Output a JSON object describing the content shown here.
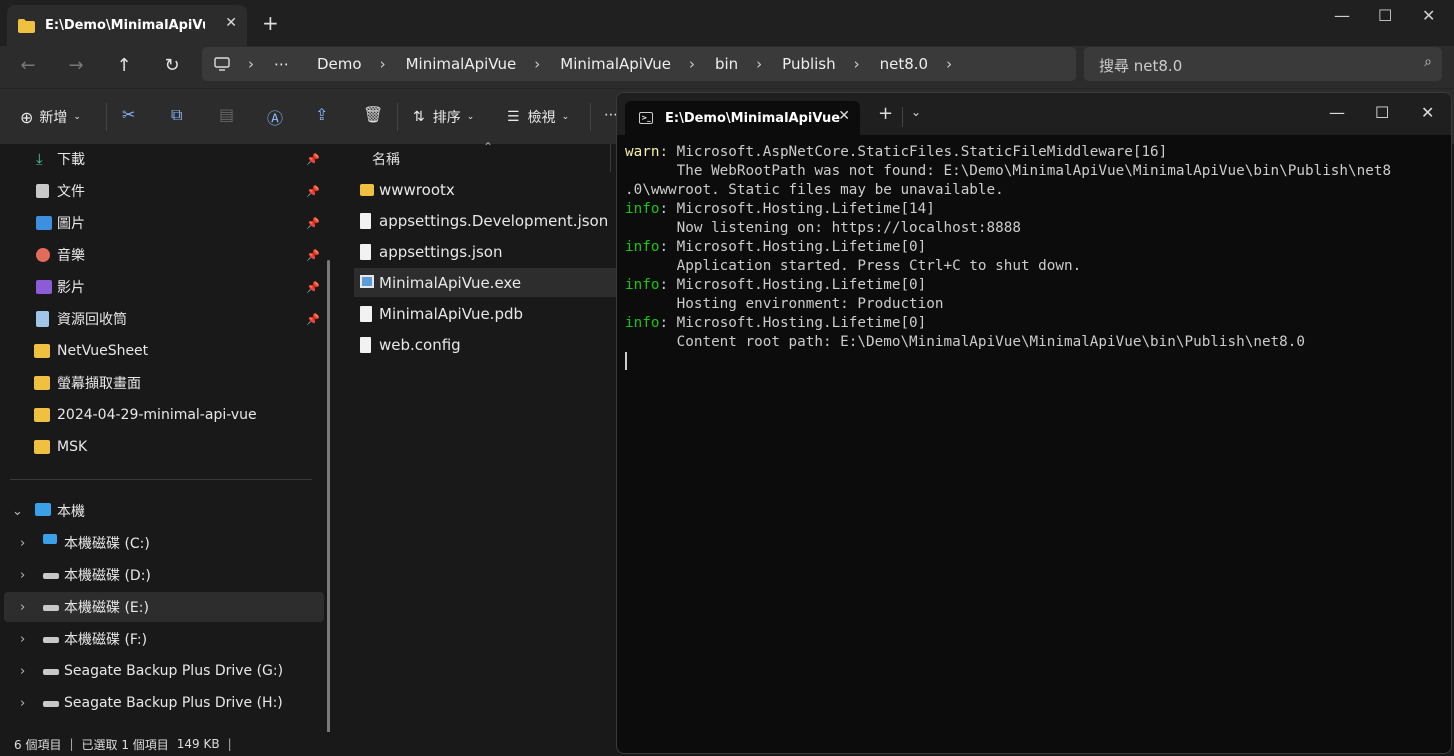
{
  "explorer": {
    "tab_title": "E:\\Demo\\MinimalApiVue",
    "new_tab": "+",
    "breadcrumb": [
      "Demo",
      "MinimalApiVue",
      "MinimalApiVue",
      "bin",
      "Publish",
      "net8.0"
    ],
    "search_placeholder": "搜尋 net8.0",
    "toolbar": {
      "new_label": "新增",
      "sort_label": "排序",
      "view_label": "檢視",
      "more": "⋯"
    },
    "sidebar": {
      "quick": [
        {
          "label": "下載",
          "icon": "download-icon",
          "pinned": true
        },
        {
          "label": "文件",
          "icon": "document-icon",
          "pinned": true
        },
        {
          "label": "圖片",
          "icon": "pictures-icon",
          "pinned": true
        },
        {
          "label": "音樂",
          "icon": "music-icon",
          "pinned": true
        },
        {
          "label": "影片",
          "icon": "videos-icon",
          "pinned": true
        },
        {
          "label": "資源回收筒",
          "icon": "recycle-bin-icon",
          "pinned": true
        },
        {
          "label": "NetVueSheet",
          "icon": "folder-icon",
          "pinned": false
        },
        {
          "label": "螢幕擷取畫面",
          "icon": "folder-icon",
          "pinned": false
        },
        {
          "label": "2024-04-29-minimal-api-vue",
          "icon": "folder-icon",
          "pinned": false
        },
        {
          "label": "MSK",
          "icon": "folder-icon",
          "pinned": false
        }
      ],
      "this_pc": "本機",
      "drives": [
        {
          "label": "本機磁碟 (C:)",
          "selected": false
        },
        {
          "label": "本機磁碟 (D:)",
          "selected": false
        },
        {
          "label": "本機磁碟 (E:)",
          "selected": true
        },
        {
          "label": "本機磁碟 (F:)",
          "selected": false
        },
        {
          "label": "Seagate Backup Plus Drive (G:)",
          "selected": false
        },
        {
          "label": "Seagate Backup Plus Drive (H:)",
          "selected": false
        }
      ]
    },
    "files": {
      "column_name": "名稱",
      "items": [
        {
          "name": "wwwrootx",
          "type": "folder",
          "selected": false
        },
        {
          "name": "appsettings.Development.json",
          "type": "file",
          "selected": false
        },
        {
          "name": "appsettings.json",
          "type": "file",
          "selected": false
        },
        {
          "name": "MinimalApiVue.exe",
          "type": "exe",
          "selected": true
        },
        {
          "name": "MinimalApiVue.pdb",
          "type": "file",
          "selected": false
        },
        {
          "name": "web.config",
          "type": "file",
          "selected": false
        }
      ]
    },
    "status": {
      "count": "6 個項目",
      "selection": "已選取 1 個項目",
      "size": "149 KB"
    }
  },
  "terminal": {
    "tab_title": "E:\\Demo\\MinimalApiVue",
    "lines": [
      {
        "level": "warn",
        "text": ": Microsoft.AspNetCore.StaticFiles.StaticFileMiddleware[16]"
      },
      {
        "level": "",
        "text": "      The WebRootPath was not found: E:\\Demo\\MinimalApiVue\\MinimalApiVue\\bin\\Publish\\net8"
      },
      {
        "level": "",
        "text": ".0\\wwwroot. Static files may be unavailable."
      },
      {
        "level": "info",
        "text": ": Microsoft.Hosting.Lifetime[14]"
      },
      {
        "level": "",
        "text": "      Now listening on: https://localhost:8888"
      },
      {
        "level": "info",
        "text": ": Microsoft.Hosting.Lifetime[0]"
      },
      {
        "level": "",
        "text": "      Application started. Press Ctrl+C to shut down."
      },
      {
        "level": "info",
        "text": ": Microsoft.Hosting.Lifetime[0]"
      },
      {
        "level": "",
        "text": "      Hosting environment: Production"
      },
      {
        "level": "info",
        "text": ": Microsoft.Hosting.Lifetime[0]"
      },
      {
        "level": "",
        "text": "      Content root path: E:\\Demo\\MinimalApiVue\\MinimalApiVue\\bin\\Publish\\net8.0"
      }
    ]
  }
}
